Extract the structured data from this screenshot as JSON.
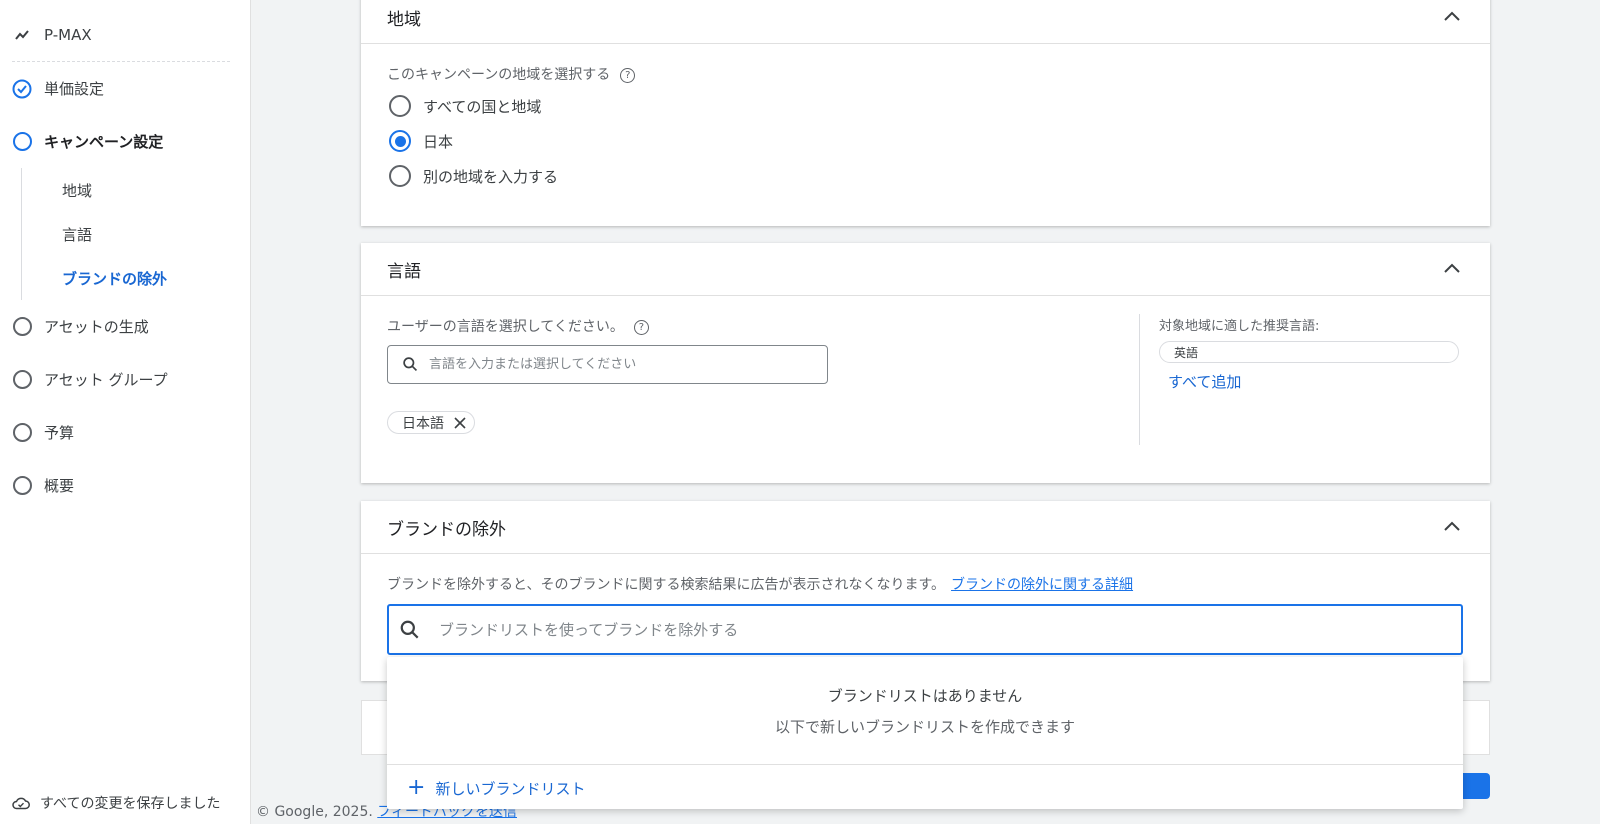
{
  "sidebar": {
    "pmax_label": "P-MAX",
    "steps": [
      {
        "label": "単価設定"
      },
      {
        "label": "キャンペーン設定"
      },
      {
        "label": "アセットの生成"
      },
      {
        "label": "アセット グループ"
      },
      {
        "label": "予算"
      },
      {
        "label": "概要"
      }
    ],
    "sub_items": [
      {
        "label": "地域"
      },
      {
        "label": "言語"
      },
      {
        "label": "ブランドの除外"
      }
    ],
    "save_status": "すべての変更を保存しました"
  },
  "region_card": {
    "title": "地域",
    "prompt": "このキャンペーンの地域を選択する",
    "options": [
      {
        "label": "すべての国と地域",
        "selected": false
      },
      {
        "label": "日本",
        "selected": true
      },
      {
        "label": "別の地域を入力する",
        "selected": false
      }
    ]
  },
  "language_card": {
    "title": "言語",
    "prompt": "ユーザーの言語を選択してください。",
    "search_placeholder": "言語を入力または選択してください",
    "selected_chip": "日本語",
    "recommended_title": "対象地域に適した推奨言語:",
    "recommended_chip": "英語",
    "add_all": "すべて追加"
  },
  "brand_card": {
    "title": "ブランドの除外",
    "description": "ブランドを除外すると、そのブランドに関する検索結果に広告が表示されなくなります。",
    "learn_more": "ブランドの除外に関する詳細",
    "search_placeholder": "ブランドリストを使ってブランドを除外する"
  },
  "dropdown": {
    "empty_title": "ブランドリストはありません",
    "empty_sub": "以下で新しいブランドリストを作成できます",
    "new_list": "新しいブランドリスト"
  },
  "footer": {
    "copyright": "© Google, 2025.",
    "feedback": "フィードバックを送信"
  },
  "colors": {
    "accent": "#1a73e8",
    "link": "#1967d2"
  }
}
